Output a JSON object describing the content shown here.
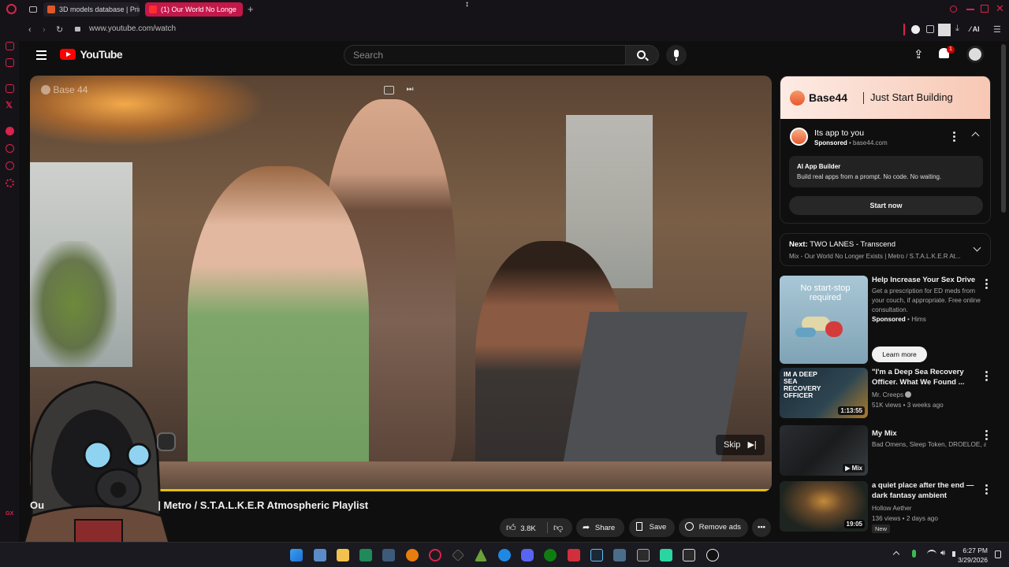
{
  "browser": {
    "tabs": [
      {
        "label": "3D models database | Prin",
        "active": false
      },
      {
        "label": "(1) Our World No Longe",
        "active": true
      }
    ],
    "url": "www.youtube.com/watch",
    "ai_label": "AI"
  },
  "youtube": {
    "logo_text": "YouTube",
    "search_placeholder": "Search",
    "notification_count": "1"
  },
  "video": {
    "watermark": "Base 44",
    "skip_label": "Skip",
    "progress_fraction": 1.0,
    "title": "Our World No Longer Exists | Metro / S.T.A.L.K.E.R Atmospheric Playlist",
    "title_visible": "Ou",
    "title_rest": "| Metro / S.T.A.L.K.E.R Atmospheric Playlist"
  },
  "actions": {
    "likes": "3.8K",
    "share": "Share",
    "save": "Save",
    "remove_ads": "Remove ads"
  },
  "ad": {
    "banner_brand": "Base44",
    "banner_tagline": "Just Start Building",
    "headline": "Its app to you",
    "sponsored": "Sponsored",
    "domain": "base44.com",
    "box_title": "AI App Builder",
    "box_text": "Build real apps from a prompt. No code. No waiting.",
    "cta": "Start now"
  },
  "next_up": {
    "label": "Next:",
    "title": "TWO LANES - Transcend",
    "subtitle": "Mix - Our World No Longer Exists | Metro / S.T.A.L.K.E.R At..."
  },
  "recommendations": [
    {
      "title": "Help Increase Your Sex Drive",
      "desc": "Get a prescription for ED meds from your couch, if appropriate. Free online consultation.",
      "sponsored": "Sponsored",
      "advertiser": "Hims",
      "thumb_text": "No start-stop required",
      "cta": "Learn more"
    },
    {
      "title": "\"I'm a Deep Sea Recovery Officer. What We Found ...",
      "channel": "Mr. Creeps",
      "meta": "51K views • 3 weeks ago",
      "duration": "1:13:55",
      "thumb_text": "IM A DEEP SEA RECOVERY OFFICER"
    },
    {
      "title": "My Mix",
      "channel": "Bad Omens, Sleep Token, DROELOE, and ...",
      "badge": "Mix"
    },
    {
      "title": "a quiet place after the end — dark fantasy ambient",
      "channel": "Hollow Aether",
      "meta": "136 views • 2 days ago",
      "duration": "19:05",
      "tag": "New"
    }
  ],
  "taskbar": {
    "time": "6:27 PM",
    "date": "3/29/2026"
  },
  "colors": {
    "opera_red": "#d9234c",
    "youtube_red": "#ff0000",
    "progress_yellow": "#e3c200",
    "background": "#0f0f0f"
  }
}
